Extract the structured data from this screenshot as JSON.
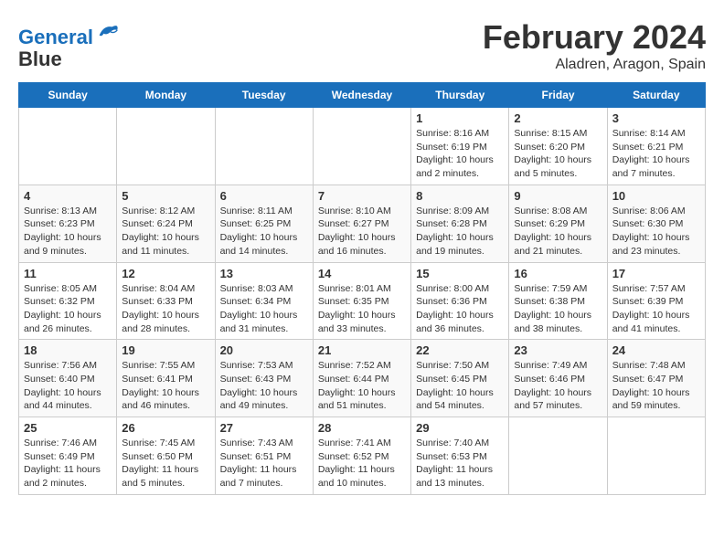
{
  "header": {
    "logo_line1": "General",
    "logo_line2": "Blue",
    "month": "February 2024",
    "location": "Aladren, Aragon, Spain"
  },
  "days_of_week": [
    "Sunday",
    "Monday",
    "Tuesday",
    "Wednesday",
    "Thursday",
    "Friday",
    "Saturday"
  ],
  "weeks": [
    [
      {
        "day": "",
        "info": ""
      },
      {
        "day": "",
        "info": ""
      },
      {
        "day": "",
        "info": ""
      },
      {
        "day": "",
        "info": ""
      },
      {
        "day": "1",
        "info": "Sunrise: 8:16 AM\nSunset: 6:19 PM\nDaylight: 10 hours and 2 minutes."
      },
      {
        "day": "2",
        "info": "Sunrise: 8:15 AM\nSunset: 6:20 PM\nDaylight: 10 hours and 5 minutes."
      },
      {
        "day": "3",
        "info": "Sunrise: 8:14 AM\nSunset: 6:21 PM\nDaylight: 10 hours and 7 minutes."
      }
    ],
    [
      {
        "day": "4",
        "info": "Sunrise: 8:13 AM\nSunset: 6:23 PM\nDaylight: 10 hours and 9 minutes."
      },
      {
        "day": "5",
        "info": "Sunrise: 8:12 AM\nSunset: 6:24 PM\nDaylight: 10 hours and 11 minutes."
      },
      {
        "day": "6",
        "info": "Sunrise: 8:11 AM\nSunset: 6:25 PM\nDaylight: 10 hours and 14 minutes."
      },
      {
        "day": "7",
        "info": "Sunrise: 8:10 AM\nSunset: 6:27 PM\nDaylight: 10 hours and 16 minutes."
      },
      {
        "day": "8",
        "info": "Sunrise: 8:09 AM\nSunset: 6:28 PM\nDaylight: 10 hours and 19 minutes."
      },
      {
        "day": "9",
        "info": "Sunrise: 8:08 AM\nSunset: 6:29 PM\nDaylight: 10 hours and 21 minutes."
      },
      {
        "day": "10",
        "info": "Sunrise: 8:06 AM\nSunset: 6:30 PM\nDaylight: 10 hours and 23 minutes."
      }
    ],
    [
      {
        "day": "11",
        "info": "Sunrise: 8:05 AM\nSunset: 6:32 PM\nDaylight: 10 hours and 26 minutes."
      },
      {
        "day": "12",
        "info": "Sunrise: 8:04 AM\nSunset: 6:33 PM\nDaylight: 10 hours and 28 minutes."
      },
      {
        "day": "13",
        "info": "Sunrise: 8:03 AM\nSunset: 6:34 PM\nDaylight: 10 hours and 31 minutes."
      },
      {
        "day": "14",
        "info": "Sunrise: 8:01 AM\nSunset: 6:35 PM\nDaylight: 10 hours and 33 minutes."
      },
      {
        "day": "15",
        "info": "Sunrise: 8:00 AM\nSunset: 6:36 PM\nDaylight: 10 hours and 36 minutes."
      },
      {
        "day": "16",
        "info": "Sunrise: 7:59 AM\nSunset: 6:38 PM\nDaylight: 10 hours and 38 minutes."
      },
      {
        "day": "17",
        "info": "Sunrise: 7:57 AM\nSunset: 6:39 PM\nDaylight: 10 hours and 41 minutes."
      }
    ],
    [
      {
        "day": "18",
        "info": "Sunrise: 7:56 AM\nSunset: 6:40 PM\nDaylight: 10 hours and 44 minutes."
      },
      {
        "day": "19",
        "info": "Sunrise: 7:55 AM\nSunset: 6:41 PM\nDaylight: 10 hours and 46 minutes."
      },
      {
        "day": "20",
        "info": "Sunrise: 7:53 AM\nSunset: 6:43 PM\nDaylight: 10 hours and 49 minutes."
      },
      {
        "day": "21",
        "info": "Sunrise: 7:52 AM\nSunset: 6:44 PM\nDaylight: 10 hours and 51 minutes."
      },
      {
        "day": "22",
        "info": "Sunrise: 7:50 AM\nSunset: 6:45 PM\nDaylight: 10 hours and 54 minutes."
      },
      {
        "day": "23",
        "info": "Sunrise: 7:49 AM\nSunset: 6:46 PM\nDaylight: 10 hours and 57 minutes."
      },
      {
        "day": "24",
        "info": "Sunrise: 7:48 AM\nSunset: 6:47 PM\nDaylight: 10 hours and 59 minutes."
      }
    ],
    [
      {
        "day": "25",
        "info": "Sunrise: 7:46 AM\nSunset: 6:49 PM\nDaylight: 11 hours and 2 minutes."
      },
      {
        "day": "26",
        "info": "Sunrise: 7:45 AM\nSunset: 6:50 PM\nDaylight: 11 hours and 5 minutes."
      },
      {
        "day": "27",
        "info": "Sunrise: 7:43 AM\nSunset: 6:51 PM\nDaylight: 11 hours and 7 minutes."
      },
      {
        "day": "28",
        "info": "Sunrise: 7:41 AM\nSunset: 6:52 PM\nDaylight: 11 hours and 10 minutes."
      },
      {
        "day": "29",
        "info": "Sunrise: 7:40 AM\nSunset: 6:53 PM\nDaylight: 11 hours and 13 minutes."
      },
      {
        "day": "",
        "info": ""
      },
      {
        "day": "",
        "info": ""
      }
    ]
  ]
}
